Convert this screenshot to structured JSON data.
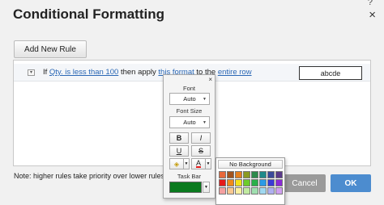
{
  "dialog": {
    "title": "Conditional Formatting",
    "help": "?",
    "close": "×"
  },
  "toolbar": {
    "add_rule_label": "Add New Rule"
  },
  "rule": {
    "collapse": "▾",
    "prefix": "If",
    "condition": "Qty. is less than 100",
    "middle": "then apply",
    "format_link": "this format",
    "to_text": "to the",
    "scope_link": "entire row",
    "preview": "abcde"
  },
  "footer": {
    "note": "Note: higher rules take priority over lower rules.",
    "cancel_label": "Cancel",
    "ok_label": "OK"
  },
  "format_popup": {
    "close": "×",
    "font_label": "Font",
    "font_value": "Auto",
    "font_size_label": "Font Size",
    "font_size_value": "Auto",
    "bold": "B",
    "italic": "I",
    "underline": "U",
    "strike": "S",
    "fill_glyph": "◈",
    "font_color_glyph": "A",
    "task_bar_label": "Task Bar",
    "task_bar_color": "#0a7a1e"
  },
  "palette": {
    "no_background_label": "No Background",
    "colors": [
      "#e8683b",
      "#a3531e",
      "#e57f1f",
      "#8a9a23",
      "#2d8a4c",
      "#1f8a8a",
      "#3a4a9a",
      "#5a3a8a",
      "#e61a1a",
      "#f08a1a",
      "#f2e21a",
      "#6ccc2a",
      "#2ab04a",
      "#2a9ae6",
      "#3a3ad6",
      "#8a2ad6",
      "#f4a0a0",
      "#f8c890",
      "#fbf0a0",
      "#c0eaa0",
      "#a0e0b0",
      "#a0d8f0",
      "#b0b0f0",
      "#d0a0f0"
    ]
  }
}
